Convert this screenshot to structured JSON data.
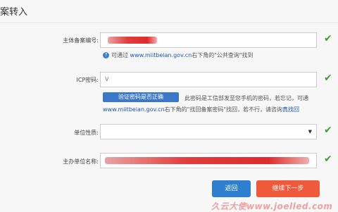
{
  "page": {
    "title": "案转入"
  },
  "form": {
    "subject_no": {
      "label": "主体备案编号:",
      "value": "",
      "hint_text": "可通过",
      "hint_link": "www.miitbeian.gov.cn",
      "hint_suffix": "右下角的\"公共查询\"找到"
    },
    "icp_password": {
      "label": "ICP密码:",
      "value": "V",
      "verify_button": "验证密码是否正确",
      "hint_line1": "此密码是工信部发至您手机的密码，若忘记，可通",
      "hint_link": "www.miitbeian.gov.cn",
      "hint_line2": "右下角的\"找回备案密码\"找回，若不行，请咨询",
      "hint_link2": "真找回"
    },
    "unit_type": {
      "label": "单位性质:",
      "value": ""
    },
    "sponsor_name": {
      "label": "主办单位名称:",
      "value": ""
    }
  },
  "actions": {
    "back": "返回",
    "next": "继续下一步"
  },
  "watermark": "久云大使www.joelled.com",
  "colors": {
    "check": "#3b9e2f",
    "back": "#2f7fd0",
    "next": "#ee5a3a",
    "link": "#1a55b8"
  }
}
